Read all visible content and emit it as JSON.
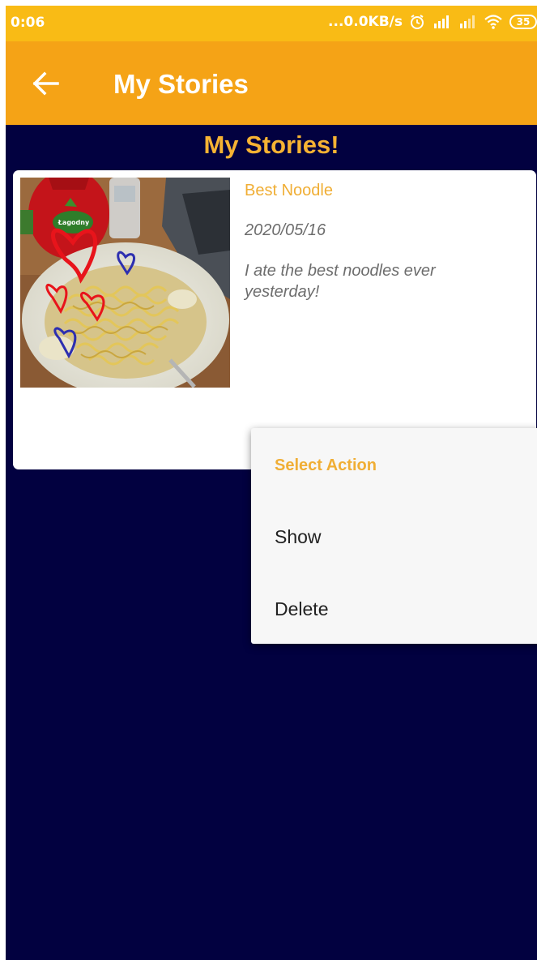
{
  "status_bar": {
    "time": "0:06",
    "network_speed": "...0.0KB/s",
    "battery_level": "35"
  },
  "app_bar": {
    "title": "My Stories",
    "color": "#f5a316"
  },
  "heading": "My Stories!",
  "story": {
    "title": "Best Noodle",
    "date": "2020/05/16",
    "description": "I ate the best noodles ever yesterday!",
    "image_ketchup_text": "Łagodny"
  },
  "context_menu": {
    "title": "Select Action",
    "items": [
      {
        "label": "Show"
      },
      {
        "label": "Delete"
      }
    ]
  },
  "colors": {
    "background": "#020140",
    "accent": "#f0ae35",
    "status_bar": "#f9bb15"
  }
}
